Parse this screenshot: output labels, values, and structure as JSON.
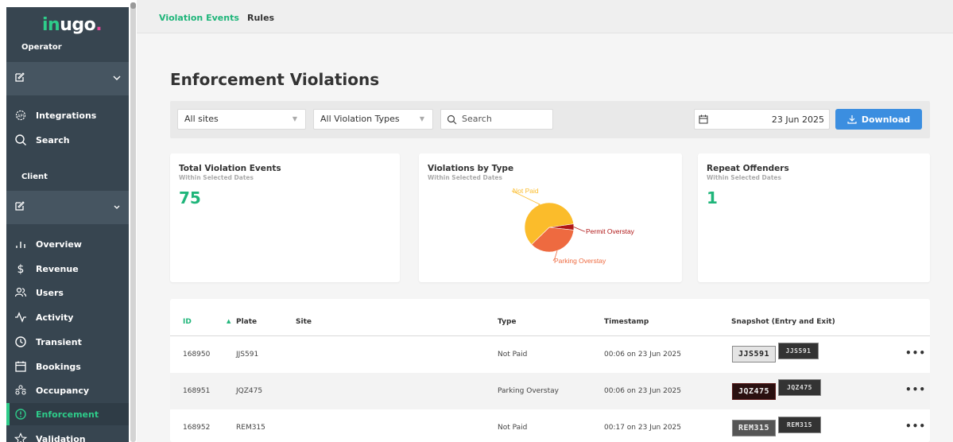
{
  "sidebar": {
    "logo": {
      "part1": "in",
      "part2": "ugo",
      "part3": "."
    },
    "operator_label": "Operator",
    "client_label": "Client",
    "operator_items": [
      {
        "label": "Integrations",
        "icon": "integrations-icon"
      },
      {
        "label": "Search",
        "icon": "search-icon"
      }
    ],
    "client_items": [
      {
        "label": "Overview",
        "icon": "bar-chart-icon"
      },
      {
        "label": "Revenue",
        "icon": "dollar-icon"
      },
      {
        "label": "Users",
        "icon": "users-icon"
      },
      {
        "label": "Activity",
        "icon": "activity-icon"
      },
      {
        "label": "Transient",
        "icon": "clock-icon"
      },
      {
        "label": "Bookings",
        "icon": "calendar-icon"
      },
      {
        "label": "Occupancy",
        "icon": "occupancy-icon"
      },
      {
        "label": "Enforcement",
        "icon": "alert-circle-icon",
        "active": true
      },
      {
        "label": "Validation",
        "icon": "star-icon"
      }
    ]
  },
  "tabs": [
    {
      "label": "Violation Events",
      "active": true
    },
    {
      "label": "Rules",
      "active": false
    }
  ],
  "page_title": "Enforcement Violations",
  "filters": {
    "site": "All sites",
    "violation_type": "All Violation Types",
    "search_placeholder": "Search",
    "date": "23 Jun 2025",
    "download_label": "Download"
  },
  "cards": {
    "total": {
      "title": "Total Violation Events",
      "subtitle": "Within Selected Dates",
      "value": "75"
    },
    "by_type": {
      "title": "Violations by Type",
      "subtitle": "Within Selected Dates"
    },
    "repeat": {
      "title": "Repeat Offenders",
      "subtitle": "Within Selected Dates",
      "value": "1"
    }
  },
  "chart_data": {
    "type": "pie",
    "title": "Violations by Type",
    "slices": [
      {
        "label": "Not Paid",
        "value": 60,
        "color": "#fbbc2b"
      },
      {
        "label": "Permit Overstay",
        "value": 4,
        "color": "#b01818"
      },
      {
        "label": "Parking Overstay",
        "value": 36,
        "color": "#ee6a40"
      }
    ]
  },
  "table": {
    "headers": {
      "id": "ID",
      "plate": "Plate",
      "site": "Site",
      "type": "Type",
      "timestamp": "Timestamp",
      "snapshot": "Snapshot (Entry and Exit)"
    },
    "rows": [
      {
        "id": "168950",
        "plate": "JJS591",
        "site": "",
        "type": "Not Paid",
        "timestamp": "00:06 on 23 Jun 2025",
        "entry_plate": "JJS591",
        "exit_plate": "JJS591"
      },
      {
        "id": "168951",
        "plate": "JQZ475",
        "site": "",
        "type": "Parking Overstay",
        "timestamp": "00:06 on 23 Jun 2025",
        "entry_plate": "JQZ475",
        "exit_plate": "JQZ475"
      },
      {
        "id": "168952",
        "plate": "REM315",
        "site": "",
        "type": "Not Paid",
        "timestamp": "00:17 on 23 Jun 2025",
        "entry_plate": "REM315",
        "exit_plate": "REM315"
      }
    ]
  },
  "colors": {
    "accent": "#1fb57a",
    "sidebar": "#374550",
    "primary_button": "#3b8ee0"
  }
}
